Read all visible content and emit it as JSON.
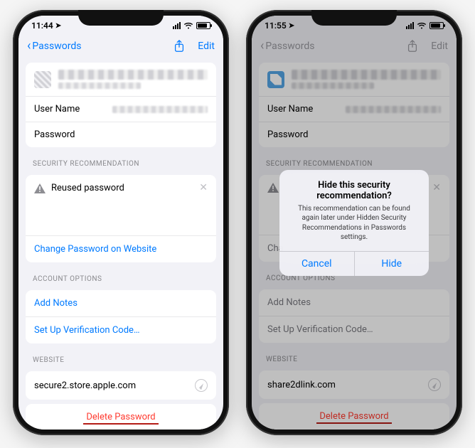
{
  "left": {
    "status": {
      "time": "11:44"
    },
    "nav": {
      "back": "Passwords",
      "edit": "Edit"
    },
    "fields": {
      "username_label": "User Name",
      "password_label": "Password"
    },
    "security": {
      "header": "SECURITY RECOMMENDATION",
      "reused": "Reused password",
      "change": "Change Password on Website"
    },
    "options": {
      "header": "ACCOUNT OPTIONS",
      "add_notes": "Add Notes",
      "verification": "Set Up Verification Code…"
    },
    "website": {
      "header": "WEBSITE",
      "url": "secure2.store.apple.com"
    },
    "delete": "Delete Password"
  },
  "right": {
    "status": {
      "time": "11:55"
    },
    "nav": {
      "back": "Passwords",
      "edit": "Edit"
    },
    "fields": {
      "username_label": "User Name",
      "password_label": "Password"
    },
    "security": {
      "header": "SECURITY RECOMMENDATION",
      "change_short": "Cha"
    },
    "options": {
      "header": "ACCOUNT OPTIONS",
      "add_notes": "Add Notes",
      "verification": "Set Up Verification Code…"
    },
    "website": {
      "header": "WEBSITE",
      "url": "share2dlink.com"
    },
    "delete": "Delete Password",
    "modal": {
      "title": "Hide this security recommendation?",
      "message": "This recommendation can be found again later under Hidden Security Recommendations in Passwords settings.",
      "cancel": "Cancel",
      "hide": "Hide"
    }
  }
}
